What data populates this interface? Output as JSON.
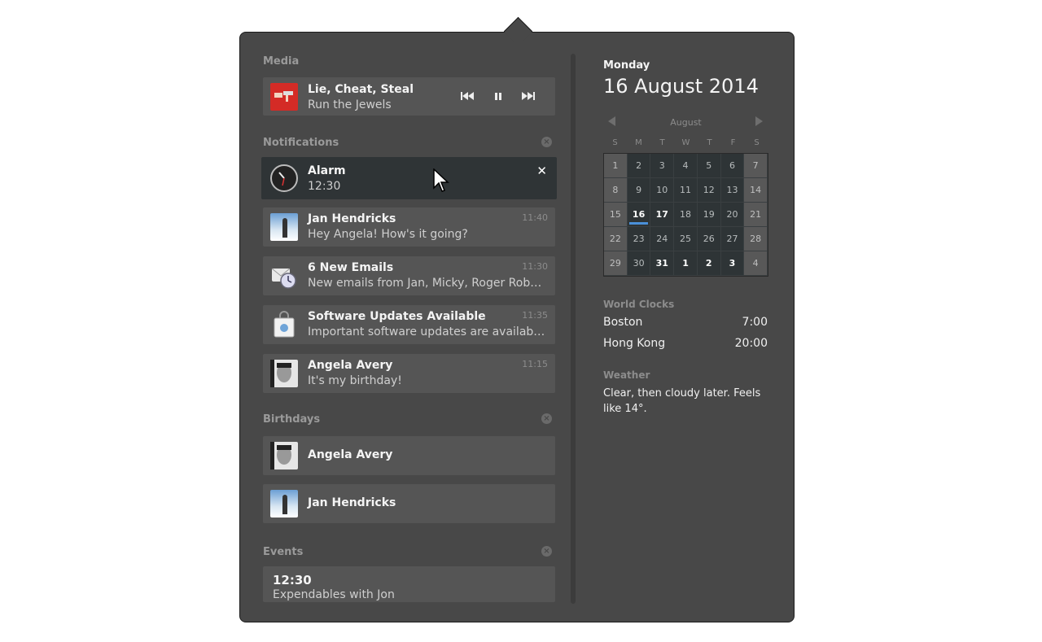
{
  "media": {
    "header": "Media",
    "track": "Lie, Cheat, Steal",
    "artist": "Run the Jewels",
    "controls": [
      "prev-icon",
      "pause-icon",
      "next-icon"
    ]
  },
  "notifications": {
    "header": "Notifications",
    "items": [
      {
        "title": "Alarm",
        "body": "12:30",
        "time": "",
        "icon": "alarm-clock-icon"
      },
      {
        "title": "Jan Hendricks",
        "body": "Hey Angela! How's it going?",
        "time": "11:40",
        "icon": "avatar"
      },
      {
        "title": "6 New Emails",
        "body": "New emails from Jan, Micky, Roger Robertson",
        "time": "11:30",
        "icon": "mail-icon"
      },
      {
        "title": "Software Updates Available",
        "body": "Important software updates are available to install",
        "time": "11:35",
        "icon": "software-bag-icon"
      },
      {
        "title": "Angela Avery",
        "body": "It's my birthday!",
        "time": "11:15",
        "icon": "avatar"
      }
    ]
  },
  "birthdays": {
    "header": "Birthdays",
    "items": [
      {
        "name": "Angela Avery"
      },
      {
        "name": "Jan Hendricks"
      }
    ]
  },
  "events": {
    "header": "Events",
    "items": [
      {
        "time": "12:30",
        "title": "Expendables with Jon"
      }
    ]
  },
  "date": {
    "weekday": "Monday",
    "full": "16 August 2014"
  },
  "calendar": {
    "month": "August",
    "days_of_week": [
      "S",
      "M",
      "T",
      "W",
      "T",
      "F",
      "S"
    ],
    "weeks": [
      [
        "1",
        "2",
        "3",
        "4",
        "5",
        "6",
        "7"
      ],
      [
        "8",
        "9",
        "10",
        "11",
        "12",
        "13",
        "14"
      ],
      [
        "15",
        "16",
        "17",
        "18",
        "19",
        "20",
        "21"
      ],
      [
        "22",
        "23",
        "24",
        "25",
        "26",
        "27",
        "28"
      ],
      [
        "29",
        "30",
        "31",
        "1",
        "2",
        "3",
        "4"
      ]
    ]
  },
  "world_clocks": {
    "header": "World Clocks",
    "items": [
      {
        "city": "Boston",
        "time": "7:00"
      },
      {
        "city": "Hong Kong",
        "time": "20:00"
      }
    ]
  },
  "weather": {
    "header": "Weather",
    "text": "Clear, then cloudy later. Feels like 14°."
  },
  "colors": {
    "accent": "#4a90d9",
    "popover_bg": "#484848",
    "card_bg": "#555555",
    "selected_card_bg": "#2f3436"
  }
}
